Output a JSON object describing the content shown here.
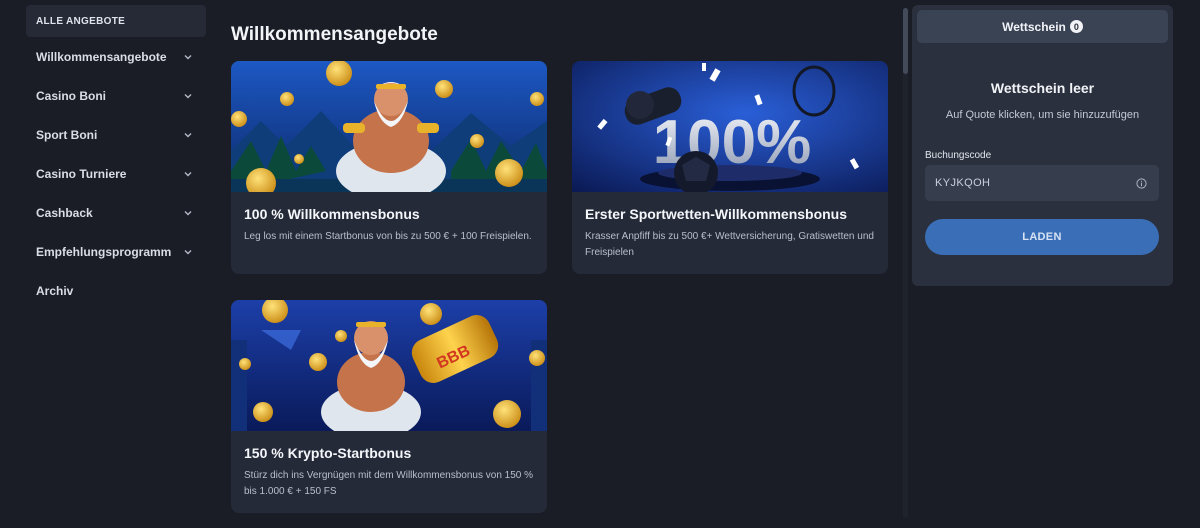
{
  "sidebar": {
    "active_label": "ALLE ANGEBOTE",
    "items": [
      {
        "label": "Willkommensangebote",
        "has_chevron": true
      },
      {
        "label": "Casino Boni",
        "has_chevron": true
      },
      {
        "label": "Sport Boni",
        "has_chevron": true
      },
      {
        "label": "Casino Turniere",
        "has_chevron": true
      },
      {
        "label": "Cashback",
        "has_chevron": true
      },
      {
        "label": "Empfehlungsprogramm",
        "has_chevron": true
      },
      {
        "label": "Archiv",
        "has_chevron": false
      }
    ]
  },
  "main": {
    "title": "Willkommensangebote",
    "cards": [
      {
        "title": "100 % Willkommensbonus",
        "description": "Leg los mit einem Startbonus von bis zu 500 € + 100 Freispielen.",
        "image": "zeus-gold-coins-illustration"
      },
      {
        "title": "Erster Sportwetten-Willkommensbonus",
        "description": "Krasser Anpfiff bis zu 500 €+ Wettversicherung, Gratiswetten und Freispielen",
        "image": "100-percent-sports-illustration",
        "image_text": "100%"
      },
      {
        "title": "150 % Krypto-Startbonus",
        "description": "Stürz dich ins Vergnügen mit dem Willkommensbonus von 150 % bis 1.000 € + 150 FS",
        "image": "zeus-bitcoin-illustration",
        "image_text": "BBB"
      }
    ]
  },
  "betslip": {
    "tab_label": "Wettschein",
    "count": "0",
    "empty_title": "Wettschein leer",
    "empty_subtitle": "Auf Quote klicken, um sie hinzuzufügen",
    "code_label": "Buchungscode",
    "code_value": "KYJKQOH",
    "load_label": "LADEN",
    "icons": {
      "info": "info-icon"
    }
  },
  "colors": {
    "background": "#1a1d25",
    "card": "#242a38",
    "betslip": "#2a303d",
    "accent_button": "#3a6fb8"
  }
}
